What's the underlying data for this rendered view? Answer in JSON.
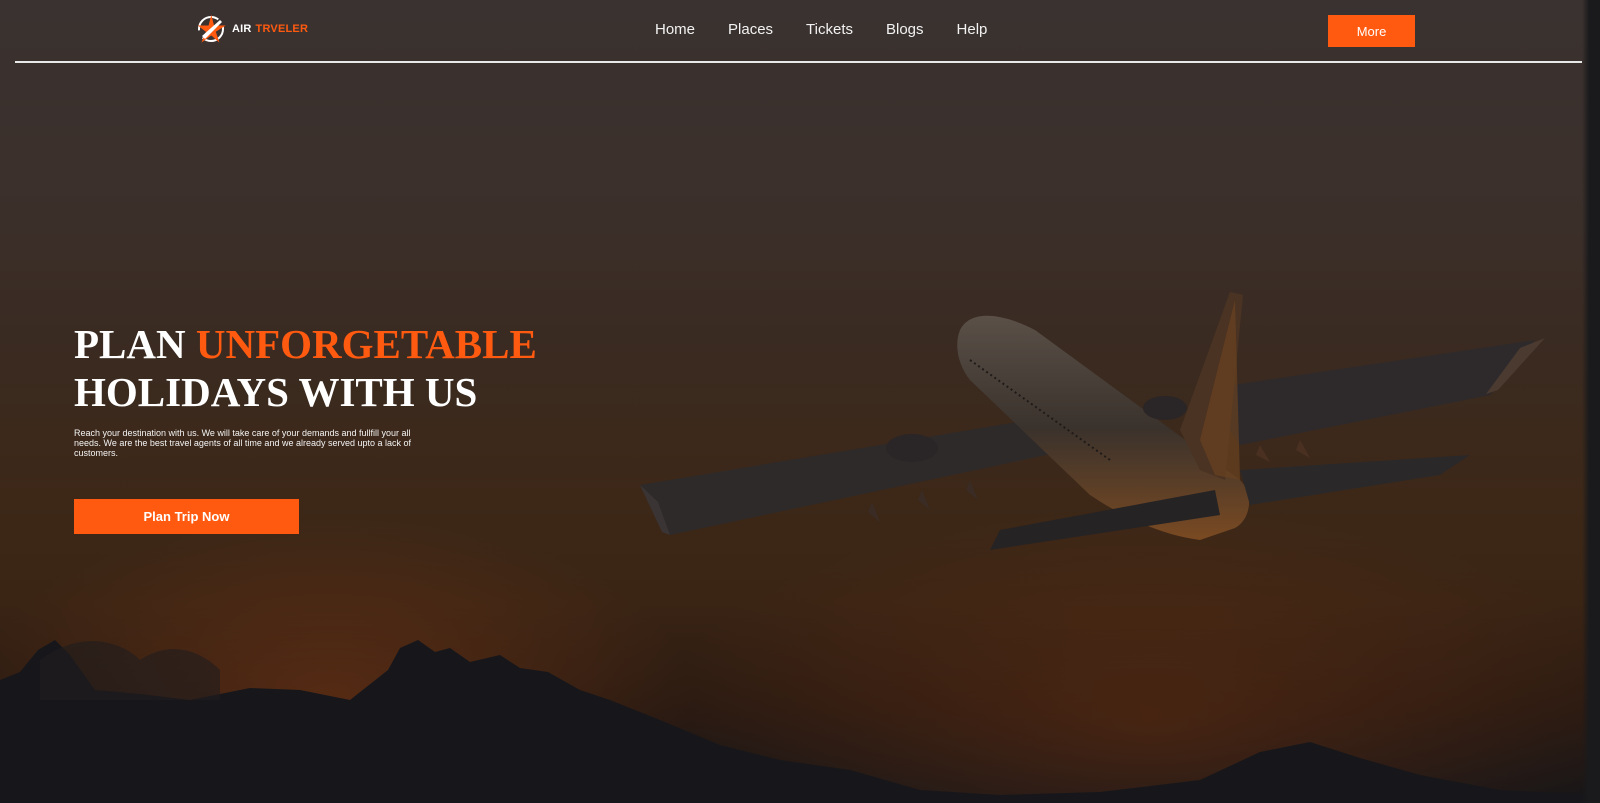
{
  "brand": {
    "name_part1": "AIR",
    "name_part2": "TRVELER"
  },
  "nav": {
    "links": [
      "Home",
      "Places",
      "Tickets",
      "Blogs",
      "Help"
    ],
    "more_label": "More"
  },
  "hero": {
    "headline_word1": "PLAN",
    "headline_accent": "UNFORGETABLE",
    "headline_line2": "HOLIDAYS WITH US",
    "subtext": "Reach your destination with us. We will take care of your demands and fullfill your all needs. We are the best travel agents of all time and we already served upto a lack of customers.",
    "cta_label": "Plan Trip Now"
  },
  "colors": {
    "accent": "#ff5a10",
    "text": "#ffffff"
  },
  "icons": {
    "logo": "airplane-star-logo-icon",
    "hero_image": "airplane-at-sunset"
  }
}
